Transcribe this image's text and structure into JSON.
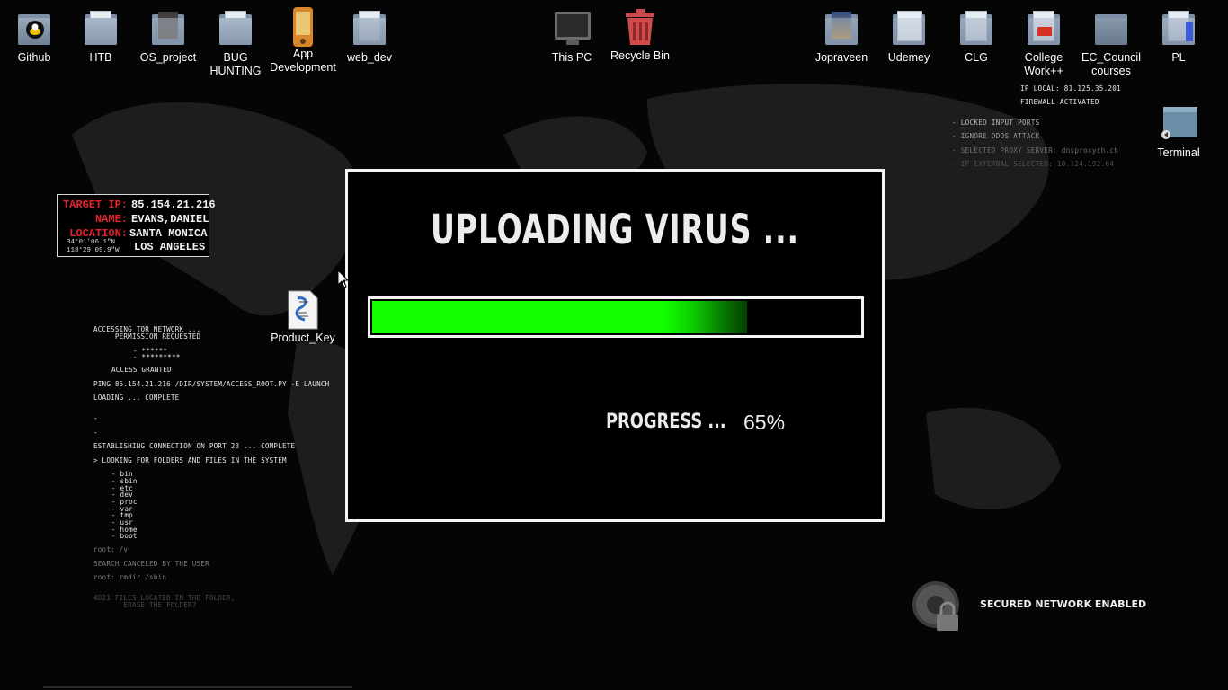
{
  "desktop_icons": [
    {
      "label": "Github",
      "icon": "github-folder-icon"
    },
    {
      "label": "HTB",
      "icon": "folder-icon"
    },
    {
      "label": "OS_project",
      "icon": "photo-folder-icon"
    },
    {
      "label": "BUG HUNTING",
      "icon": "folder-icon"
    },
    {
      "label": "App Development",
      "icon": "android-app-icon"
    },
    {
      "label": "web_dev",
      "icon": "folder-icon"
    },
    {
      "label": "This PC",
      "icon": "monitor-icon"
    },
    {
      "label": "Recycle Bin",
      "icon": "recycle-bin-icon"
    },
    {
      "label": "Jopraveen",
      "icon": "photo-folder-icon"
    },
    {
      "label": "Udemey",
      "icon": "document-folder-icon"
    },
    {
      "label": "CLG",
      "icon": "document-folder-icon"
    },
    {
      "label": "College Work++",
      "icon": "pdf-folder-icon"
    },
    {
      "label": "EC_Council courses",
      "icon": "folder-icon"
    },
    {
      "label": "PL",
      "icon": "folder-icon"
    },
    {
      "label": "Terminal",
      "icon": "terminal-shortcut-icon"
    },
    {
      "label": "Product_Key",
      "icon": "script-file-icon"
    }
  ],
  "target_box": {
    "target_ip_label": "TARGET IP:",
    "target_ip": "85.154.21.216",
    "name_label": "NAME:",
    "name": "EVANS,DANIEL",
    "location_label": "LOCATION:",
    "location_1": "SANTA MONICA",
    "location_2": "LOS ANGELES",
    "coord_lat": "34°01'06.1\"N",
    "coord_lon": "118°29'09.9\"W"
  },
  "log_lines": [
    "ACCESSING TOR NETWORK ...",
    "     PERMISSION REQUESTED",
    "- ******",
    "- *********",
    "ACCESS GRANTED",
    "PING 85.154.21.216 /DIR/SYSTEM/ACCESS_ROOT.PY -E LAUNCH",
    "LOADING ... COMPLETE",
    "-",
    "-",
    "ESTABLISHING CONNECTION ON PORT 23 ... COMPLETE",
    "> LOOKING FOR FOLDERS AND FILES IN THE SYSTEM",
    "- bin",
    "- sbin",
    "- etc",
    "- dev",
    "- proc",
    "- var",
    "- tmp",
    "- usr",
    "- home",
    "- boot",
    "root: /v",
    "SEARCH CANCELED BY THE USER",
    "root: rmdir /sbin",
    "4821 FILES LOCATED IN THE FOLDER,",
    "       ERASE THE FOLDER?"
  ],
  "right_info": {
    "ip_local": "IP LOCAL: 81.125.35.201",
    "firewall": "FIREWALL ACTIVATED",
    "locked_ports": "- LOCKED INPUT PORTS",
    "ignore_ddos": "- IGNORE DDOS ATTACK",
    "proxy": "- SELECTED PROXY SERVER: dnsproxych.ch",
    "ip_external": "- IP EXTERNAL SELECTED: 10.124.192.64"
  },
  "dialog": {
    "title": "UPLOADING VIRUS ...",
    "progress_label": "PROGRESS ...",
    "progress_value": "65%",
    "progress_fraction": 0.77,
    "fill_color": "#12ff00"
  },
  "network": {
    "status": "SECURED NETWORK ENABLED",
    "icon": "lock-icon"
  }
}
